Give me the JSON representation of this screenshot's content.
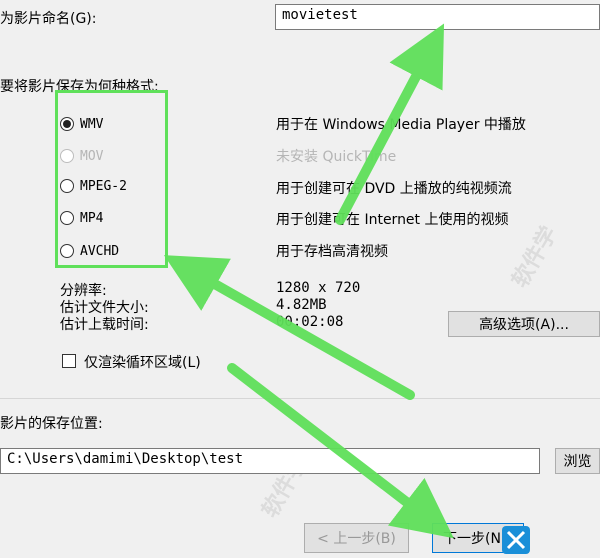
{
  "movie_name": {
    "label": "为影片命名(G):",
    "value": "movietest"
  },
  "format": {
    "section_label": "要将影片保存为何种格式:",
    "options": [
      {
        "label": "WMV",
        "selected": true,
        "enabled": true,
        "description": "用于在 Windows Media Player 中播放"
      },
      {
        "label": "MOV",
        "selected": false,
        "enabled": false,
        "description": "未安装 QuickTime"
      },
      {
        "label": "MPEG-2",
        "selected": false,
        "enabled": true,
        "description": "用于创建可在 DVD 上播放的纯视频流"
      },
      {
        "label": "MP4",
        "selected": false,
        "enabled": true,
        "description": "用于创建可在 Internet 上使用的视频"
      },
      {
        "label": "AVCHD",
        "selected": false,
        "enabled": true,
        "description": "用于存档高清视频"
      }
    ]
  },
  "info": {
    "resolution_label": "分辨率:",
    "resolution_value": "1280 x 720",
    "filesize_label": "估计文件大小:",
    "filesize_value": "4.82MB",
    "upload_label": "估计上载时间:",
    "upload_value": "00:02:08"
  },
  "advanced_button": "高级选项(A)...",
  "loop_checkbox": {
    "label": "仅渲染循环区域(L)",
    "checked": false
  },
  "save_location": {
    "label": "影片的保存位置:",
    "value": "C:\\Users\\damimi\\Desktop\\test",
    "browse": "浏览"
  },
  "nav": {
    "back": "< 上一步(B)",
    "next": "下一步(N)"
  },
  "colors": {
    "highlight": "#5fe05a"
  },
  "icons": {
    "logo": "site-logo-icon"
  }
}
